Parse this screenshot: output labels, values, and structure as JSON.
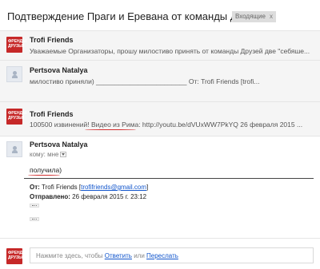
{
  "thread": {
    "subject": "Подтверждение Праги и Еревана от команды Друзей.",
    "label": "Входящие",
    "label_close": "x"
  },
  "messages": [
    {
      "sender": "Trofi Friends",
      "snippet": "Уважаемые Организаторы, прошу милостиво принять от команды Друзей две \"себяше...",
      "avatar": "trofi-logo"
    },
    {
      "sender": "Pertsova Natalya",
      "snippet": "милостиво приняли) ________________________ От: Trofi Friends [trofi...",
      "avatar": "person-icon"
    },
    {
      "sender": "Trofi Friends",
      "snippet_prefix": "100500 извинений! ",
      "snippet_highlight": "Видео из Рима",
      "snippet_suffix": ": http://youtu.be/dVUxWW7PkYQ 26 февраля 2015 ...",
      "avatar": "trofi-logo"
    },
    {
      "sender": "Pertsova Natalya",
      "to_label": "кому: мне",
      "body": "получила)",
      "quote_from_label": "От:",
      "quote_from_name": "Trofi Friends [",
      "quote_from_email": "trofifriends@gmail.com",
      "quote_from_end": "]",
      "quote_sent_label": "Отправлено:",
      "quote_sent_value": "26 февраля 2015 г. 23:12",
      "avatar": "person-icon"
    }
  ],
  "logo_text": "ФРЕНДЫ ДРУЗЬЯ",
  "reply": {
    "prefix": "Нажмите здесь, чтобы ",
    "reply_link": "Ответить",
    "middle": " или ",
    "forward_link": "Переслать"
  },
  "colors": {
    "accent_red": "#c62828",
    "link_blue": "#1155cc",
    "annotation_red": "#d32f2f"
  }
}
